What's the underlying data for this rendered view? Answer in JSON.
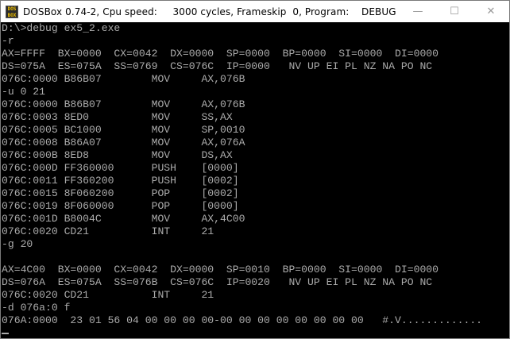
{
  "window": {
    "title": "DOSBox 0.74-2, Cpu speed:     3000 cycles, Frameskip  0, Program:    DEBUG",
    "icon_label": "DOS BOX",
    "controls": {
      "minimize": "—",
      "maximize": "☐",
      "close": "✕"
    }
  },
  "console": {
    "lines": [
      "D:\\>debug ex5_2.exe",
      "-r",
      "AX=FFFF  BX=0000  CX=0042  DX=0000  SP=0000  BP=0000  SI=0000  DI=0000",
      "DS=075A  ES=075A  SS=0769  CS=076C  IP=0000   NV UP EI PL NZ NA PO NC",
      "076C:0000 B86B07        MOV     AX,076B",
      "-u 0 21",
      "076C:0000 B86B07        MOV     AX,076B",
      "076C:0003 8ED0          MOV     SS,AX",
      "076C:0005 BC1000        MOV     SP,0010",
      "076C:0008 B86A07        MOV     AX,076A",
      "076C:000B 8ED8          MOV     DS,AX",
      "076C:000D FF360000      PUSH    [0000]",
      "076C:0011 FF360200      PUSH    [0002]",
      "076C:0015 8F060200      POP     [0002]",
      "076C:0019 8F060000      POP     [0000]",
      "076C:001D B8004C        MOV     AX,4C00",
      "076C:0020 CD21          INT     21",
      "-g 20",
      "",
      "AX=4C00  BX=0000  CX=0042  DX=0000  SP=0010  BP=0000  SI=0000  DI=0000",
      "DS=076A  ES=075A  SS=076B  CS=076C  IP=0020   NV UP EI PL NZ NA PO NC",
      "076C:0020 CD21          INT     21",
      "-d 076a:0 f",
      "076A:0000  23 01 56 04 00 00 00 00-00 00 00 00 00 00 00 00   #.V............."
    ]
  }
}
